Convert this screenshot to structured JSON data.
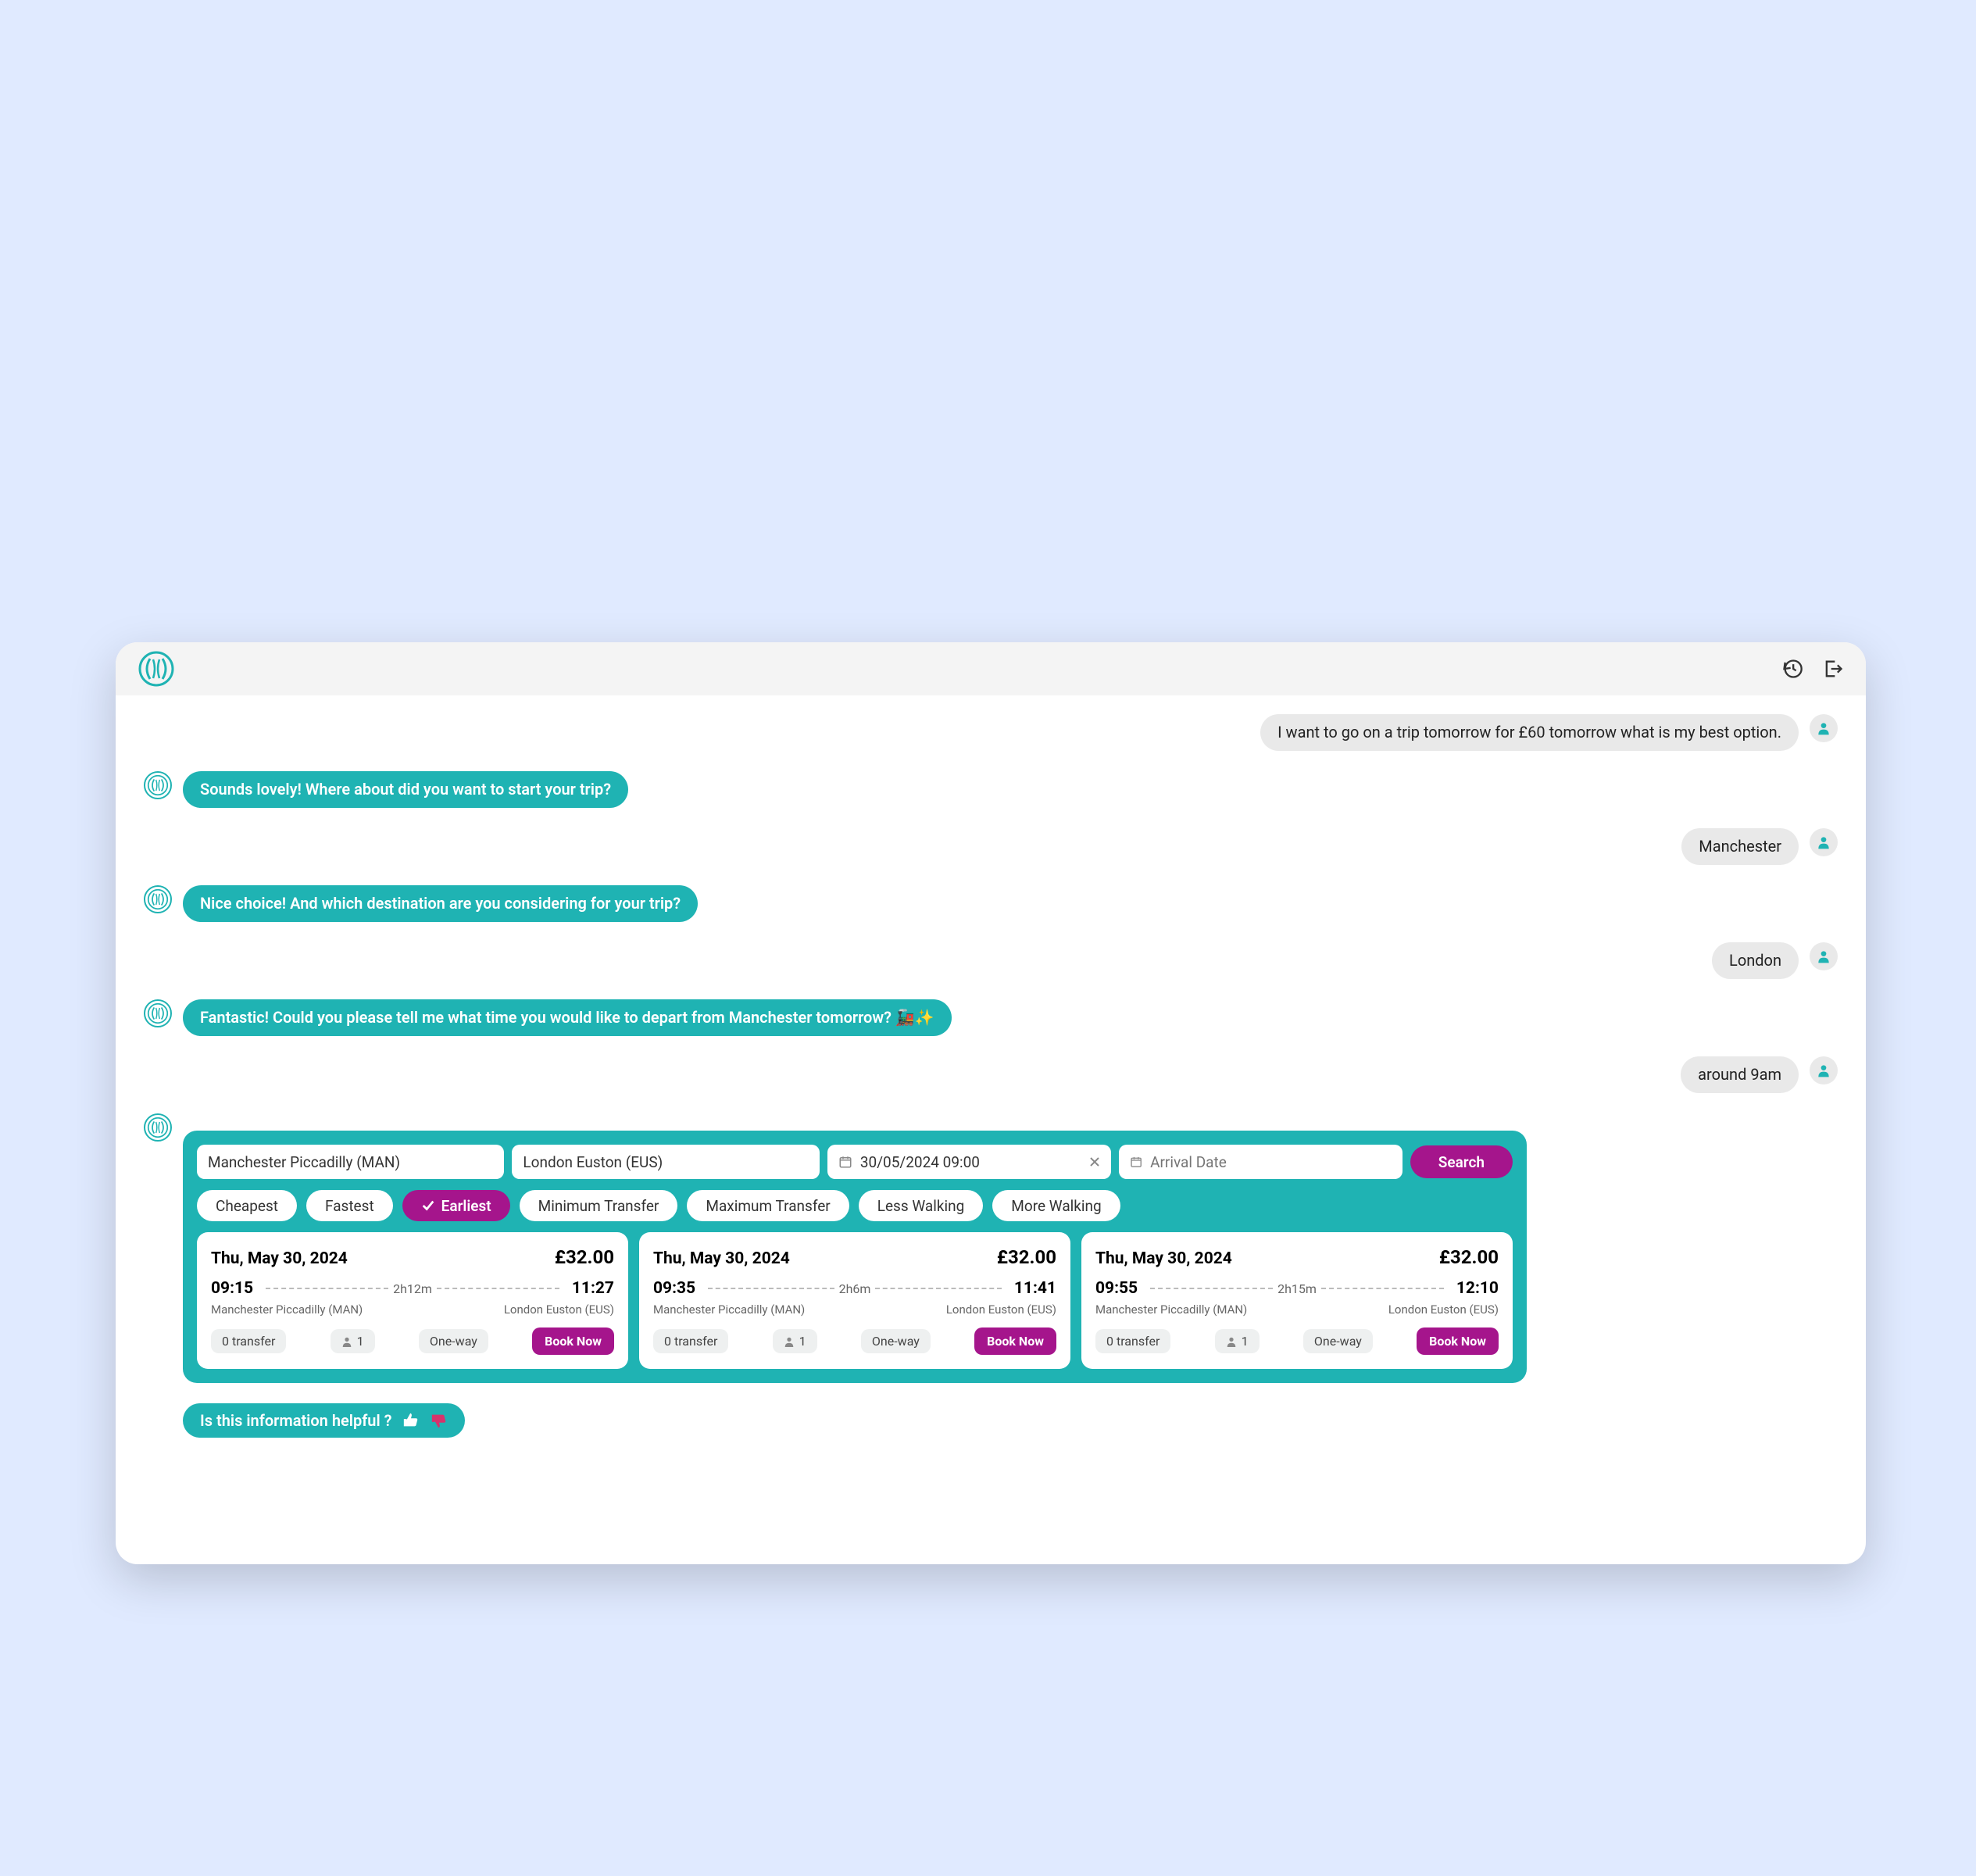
{
  "messages": {
    "u1": "I want to go on a trip tomorrow for £60 tomorrow what is my best option.",
    "b1": "Sounds lovely! Where about did you want to start your trip?",
    "u2": "Manchester",
    "b2": "Nice choice! And which destination are you considering for your trip?",
    "u3": "London",
    "b3": "Fantastic! Could you please tell me what time you would like to depart from Manchester tomorrow? 🚂✨",
    "u4": "around 9am"
  },
  "search": {
    "from": "Manchester Piccadilly (MAN)",
    "to": "London Euston (EUS)",
    "departure": "30/05/2024 09:00",
    "arrival_placeholder": "Arrival Date",
    "button": "Search"
  },
  "filters": [
    "Cheapest",
    "Fastest",
    "Earliest",
    "Minimum Transfer",
    "Maximum Transfer",
    "Less Walking",
    "More Walking"
  ],
  "active_filter": 2,
  "results": [
    {
      "date": "Thu, May 30, 2024",
      "price": "£32.00",
      "dep": "09:15",
      "arr": "11:27",
      "dur": "2h12m",
      "from": "Manchester Piccadilly (MAN)",
      "to": "London Euston (EUS)",
      "transfers": "0 transfer",
      "pax": "1",
      "way": "One-way",
      "book": "Book Now"
    },
    {
      "date": "Thu, May 30, 2024",
      "price": "£32.00",
      "dep": "09:35",
      "arr": "11:41",
      "dur": "2h6m",
      "from": "Manchester Piccadilly (MAN)",
      "to": "London Euston (EUS)",
      "transfers": "0 transfer",
      "pax": "1",
      "way": "One-way",
      "book": "Book Now"
    },
    {
      "date": "Thu, May 30, 2024",
      "price": "£32.00",
      "dep": "09:55",
      "arr": "12:10",
      "dur": "2h15m",
      "from": "Manchester Piccadilly (MAN)",
      "to": "London Euston (EUS)",
      "transfers": "0 transfer",
      "pax": "1",
      "way": "One-way",
      "book": "Book Now"
    }
  ],
  "helpful": "Is this information helpful ?"
}
